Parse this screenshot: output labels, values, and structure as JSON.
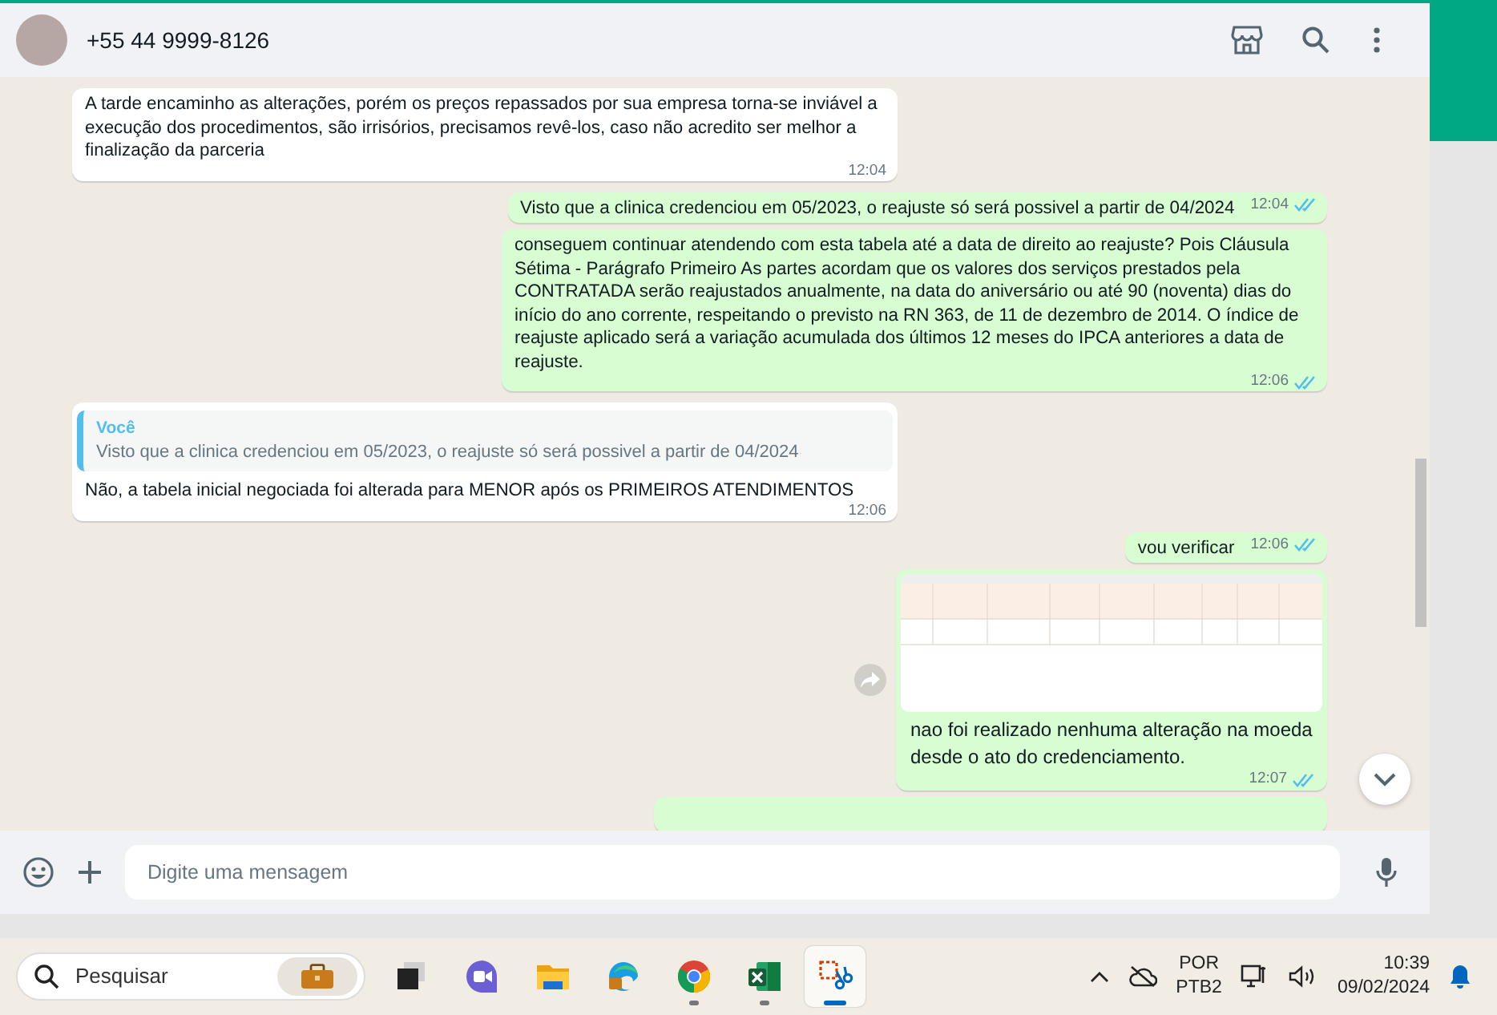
{
  "contact": {
    "name": "+55 44 9999-8126"
  },
  "messages": [
    {
      "kind": "text",
      "outgoing": false,
      "text": "A tarde encaminho as alterações, porém os preços repassados por sua empresa torna-se inviável a execução dos procedimentos, são irrisórios, precisamos revê-los, caso não acredito ser melhor a finalização da parceria",
      "time": "12:04"
    },
    {
      "kind": "text",
      "outgoing": true,
      "text": "Visto que a clinica credenciou em 05/2023, o reajuste só será possivel a partir de 04/2024",
      "time": "12:04",
      "read": true
    },
    {
      "kind": "text",
      "outgoing": true,
      "text": "conseguem continuar atendendo com esta tabela até a data de direito ao reajuste? Pois Cláusula Sétima - Parágrafo Primeiro As partes acordam que os valores dos serviços prestados pela CONTRATADA serão reajustados anualmente, na data do aniversário ou até 90 (noventa) dias do início do ano corrente, respeitando o previsto na RN 363, de 11 de dezembro de 2014. O índice de reajuste aplicado será a variação acumulada dos últimos 12 meses do IPCA anteriores a data de reajuste.",
      "time": "12:06",
      "read": true
    },
    {
      "kind": "quote",
      "outgoing": false,
      "quote_author": "Você",
      "quote_text": "Visto que a clinica credenciou em 05/2023, o reajuste só será possivel a partir de 04/2024",
      "text": "Não, a tabela inicial negociada foi alterada para MENOR após os PRIMEIROS ATENDIMENTOS",
      "time": "12:06"
    },
    {
      "kind": "text",
      "outgoing": true,
      "text": "vou verificar",
      "time": "12:06",
      "read": true
    },
    {
      "kind": "image",
      "outgoing": true,
      "text": "nao foi realizado nenhuma alteração na moeda desde o ato do credenciamento.",
      "time": "12:07",
      "read": true
    },
    {
      "kind": "cut",
      "outgoing": true
    }
  ],
  "composer": {
    "placeholder": "Digite uma mensagem"
  },
  "taskbar": {
    "search_placeholder": "Pesquisar",
    "apps": [
      {
        "kind": "taskview",
        "running": false,
        "selected": false
      },
      {
        "kind": "meet",
        "running": false,
        "selected": false
      },
      {
        "kind": "folder",
        "running": false,
        "selected": false
      },
      {
        "kind": "edge",
        "running": false,
        "selected": false
      },
      {
        "kind": "chrome",
        "running": true,
        "selected": false
      },
      {
        "kind": "excel",
        "running": true,
        "selected": false
      },
      {
        "kind": "snip",
        "running": true,
        "selected": true
      }
    ],
    "language": "POR",
    "layout": "PTB2",
    "time": "10:39",
    "date": "09/02/2024"
  }
}
